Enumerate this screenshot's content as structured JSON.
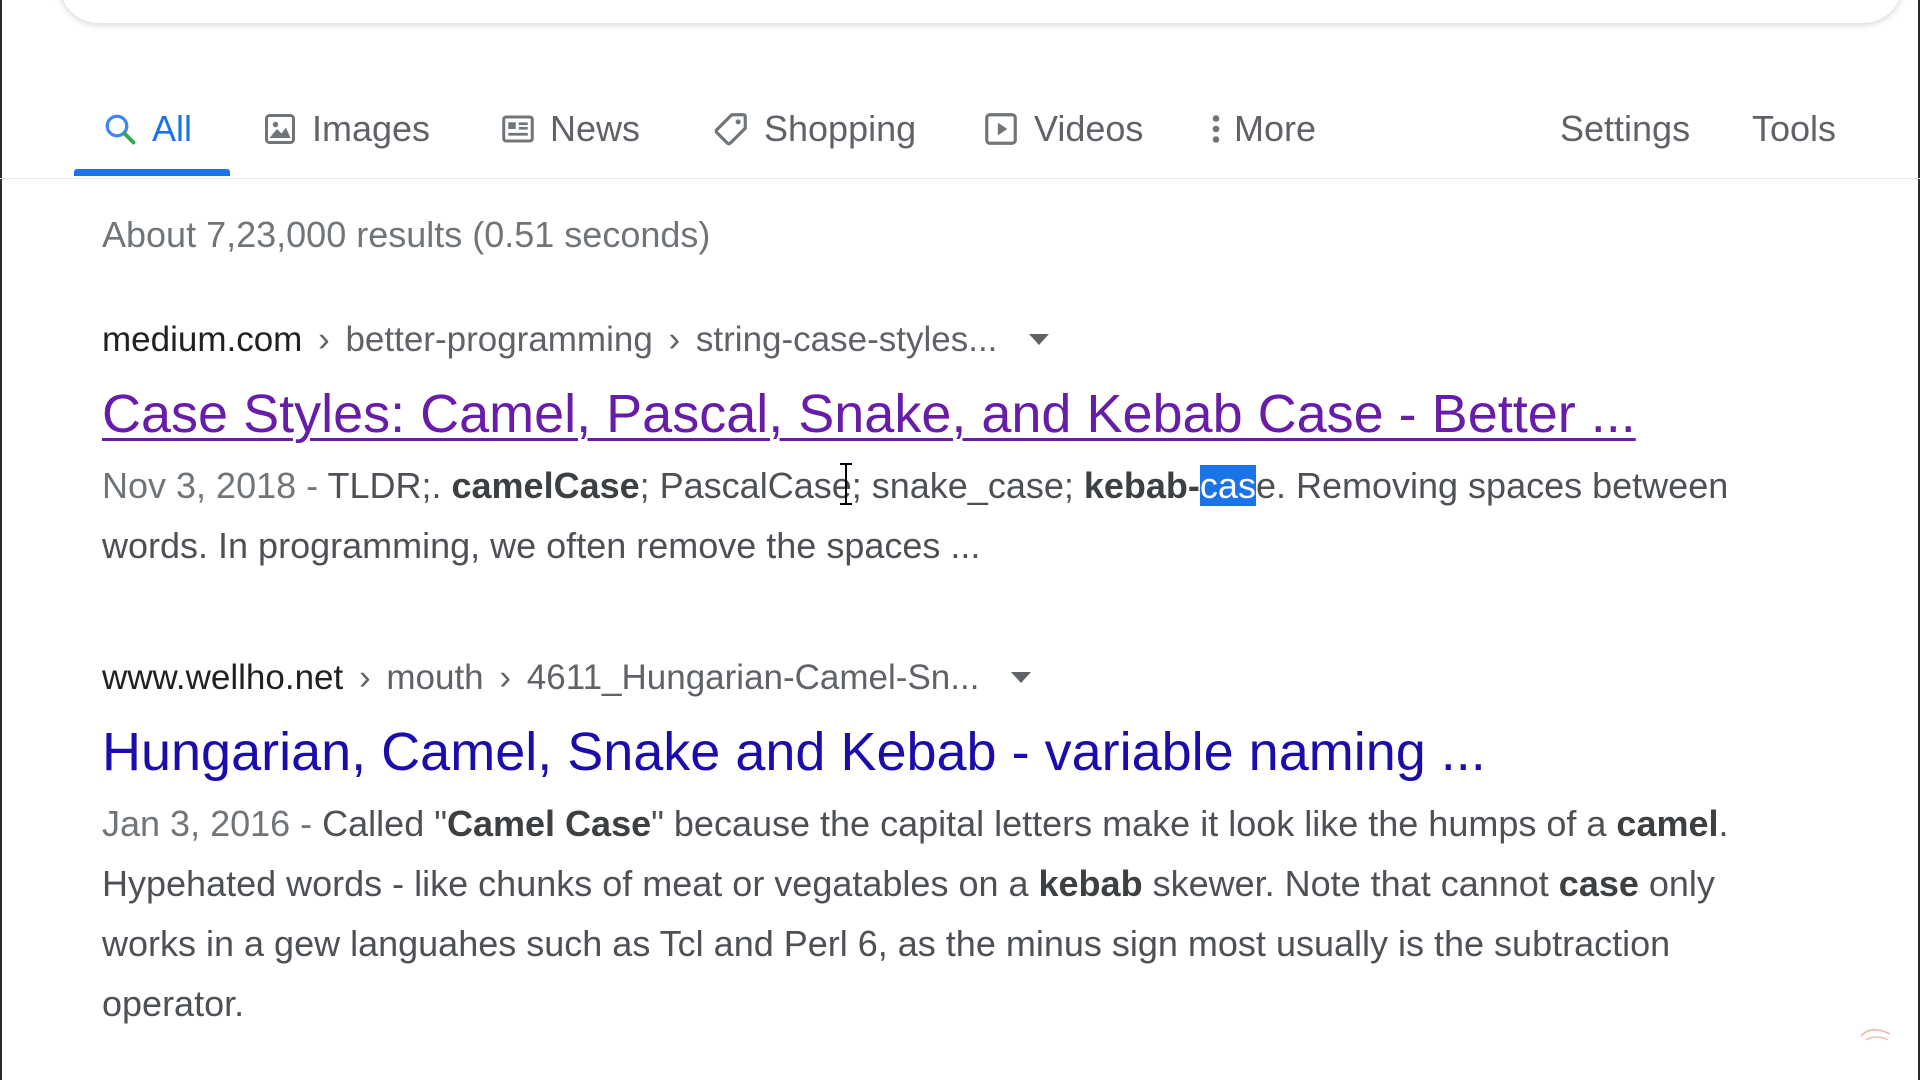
{
  "tabs": {
    "all": "All",
    "images": "Images",
    "news": "News",
    "shopping": "Shopping",
    "videos": "Videos",
    "more": "More",
    "settings": "Settings",
    "tools": "Tools",
    "active": "All"
  },
  "stats": "About 7,23,000 results (0.51 seconds)",
  "results": [
    {
      "domain": "medium.com",
      "path1": "better-programming",
      "path2": "string-case-styles...",
      "separator": "›",
      "title": "Case Styles: Camel, Pascal, Snake, and Kebab Case - Better ...",
      "visited": true,
      "date": "Nov 3, 2018",
      "snippet_parts": {
        "dash": " - ",
        "t1": "TLDR;. ",
        "b1": "camelCase",
        "t2": "; PascalCase; snake_case; ",
        "b2": "kebab-",
        "sel": "cas",
        "b3": "e",
        "t3": ". Removing spaces between words. In programming, we often remove the spaces ..."
      }
    },
    {
      "domain": "www.wellho.net",
      "path1": "mouth",
      "path2": "4611_Hungarian-Camel-Sn...",
      "separator": "›",
      "title": "Hungarian, Camel, Snake and Kebab - variable naming ...",
      "visited": false,
      "date": "Jan 3, 2016",
      "snippet_parts": {
        "dash": " - ",
        "t1": "Called \"",
        "b1": "Camel Case",
        "t2": "\" because the capital letters make it look like the humps of a ",
        "b2": "camel",
        "t3": ". Hypehated words - like chunks of meat or vegatables on a ",
        "b3": "kebab",
        "t4": " skewer. Note that cannot ",
        "b4": "case",
        "t5": " only works in a gew languahes such as Tcl and Perl 6, as the minus sign most usually is the subtraction operator."
      }
    }
  ],
  "colors": {
    "accent": "#1a73e8",
    "visited_link": "#681da8",
    "link": "#1a0dab",
    "selection": "#1a73e8"
  },
  "icons": [
    "search-icon",
    "image-icon",
    "news-icon",
    "tag-icon",
    "play-icon",
    "more-vert-icon",
    "dropdown-caret-icon",
    "text-cursor-icon"
  ]
}
